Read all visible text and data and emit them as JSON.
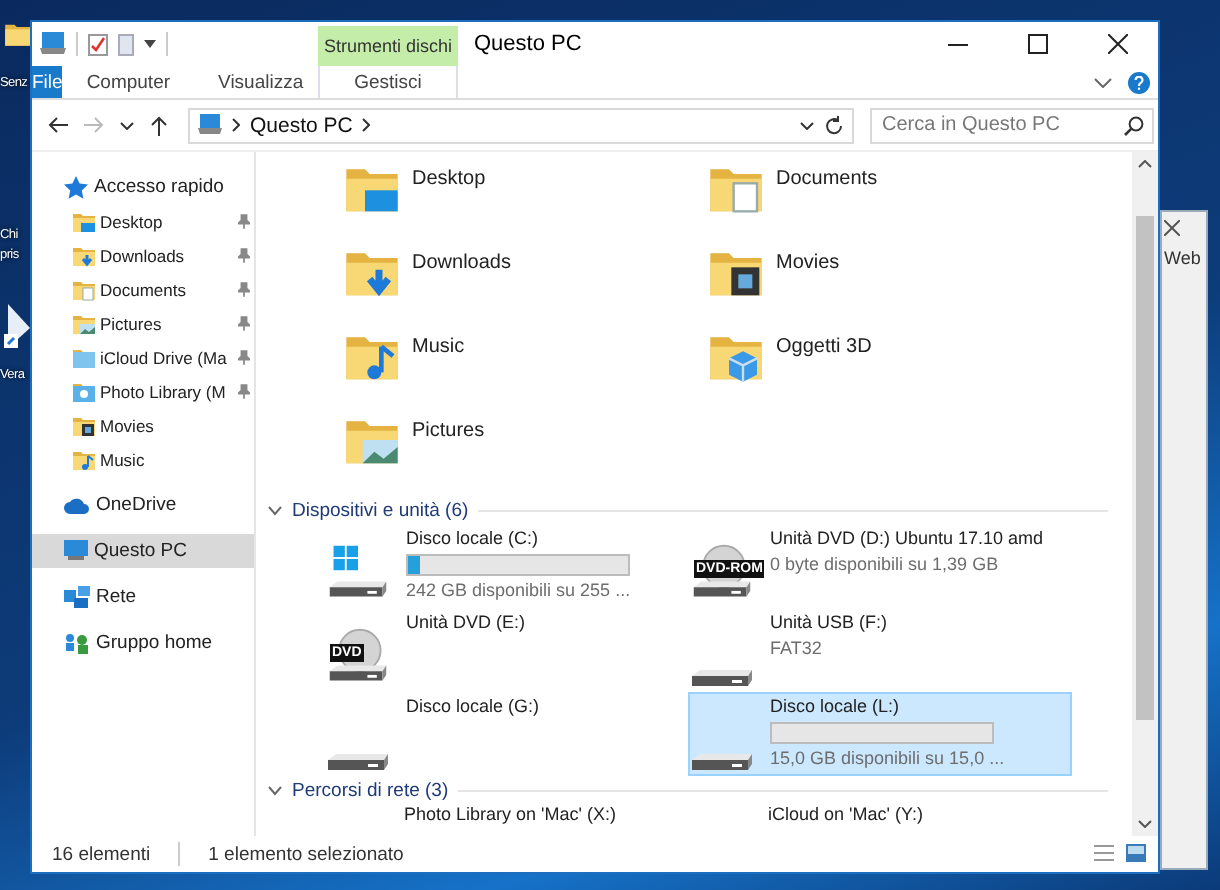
{
  "desktop": {
    "labels": [
      "Senz",
      "Chi",
      "pris",
      "Vera"
    ]
  },
  "background_window": {
    "text": "Web"
  },
  "window": {
    "title": "Questo PC",
    "tool_group": "Strumenti dischi",
    "ribbon_tabs": [
      {
        "label": "File",
        "kind": "file"
      },
      {
        "label": "Computer",
        "kind": "tab"
      },
      {
        "label": "Visualizza",
        "kind": "tab"
      },
      {
        "label": "Gestisci",
        "kind": "tool"
      }
    ]
  },
  "address": {
    "crumbs": [
      "Questo PC"
    ]
  },
  "search": {
    "placeholder": "Cerca in Questo PC"
  },
  "sidebar": {
    "items": [
      {
        "label": "Accesso rapido",
        "kind": "quick",
        "selected": false,
        "children": [
          {
            "label": "Desktop",
            "kind": "desktop",
            "pinned": true,
            "selected": false
          },
          {
            "label": "Downloads",
            "kind": "downloads",
            "pinned": true,
            "selected": false
          },
          {
            "label": "Documents",
            "kind": "documents",
            "pinned": true,
            "selected": false
          },
          {
            "label": "Pictures",
            "kind": "pictures",
            "pinned": true,
            "selected": false
          },
          {
            "label": "iCloud Drive (Ma",
            "kind": "cloudfolder",
            "pinned": true,
            "selected": false
          },
          {
            "label": "Photo Library (M",
            "kind": "photos",
            "pinned": true,
            "selected": false
          },
          {
            "label": "Movies",
            "kind": "movies",
            "pinned": false,
            "selected": false
          },
          {
            "label": "Music",
            "kind": "music",
            "pinned": false,
            "selected": false
          }
        ]
      },
      {
        "label": "OneDrive",
        "kind": "onedrive",
        "selected": false
      },
      {
        "label": "Questo PC",
        "kind": "pc",
        "selected": true
      },
      {
        "label": "Rete",
        "kind": "network",
        "selected": false
      },
      {
        "label": "Gruppo home",
        "kind": "homegroup",
        "selected": false
      }
    ]
  },
  "folders": [
    {
      "name": "Desktop",
      "kind": "desktop"
    },
    {
      "name": "Documents",
      "kind": "documents"
    },
    {
      "name": "Downloads",
      "kind": "downloads"
    },
    {
      "name": "Movies",
      "kind": "movies"
    },
    {
      "name": "Music",
      "kind": "music"
    },
    {
      "name": "Oggetti 3D",
      "kind": "cube"
    },
    {
      "name": "Pictures",
      "kind": "pictures"
    }
  ],
  "sections": [
    {
      "title": "Dispositivi e unità (6)",
      "expanded": true,
      "items": [
        {
          "name": "Disco locale (C:)",
          "kind": "hdd-windows",
          "level": 0.05,
          "detail": "242 GB disponibili su 255 ...",
          "selected": false
        },
        {
          "name": "Unità DVD (D:) Ubuntu 17.10 amd",
          "kind": "dvd-rom",
          "icon_label": "DVD-ROM",
          "detail": "0 byte disponibili su 1,39 GB",
          "selected": false
        },
        {
          "name": "Unità DVD (E:)",
          "kind": "dvd",
          "icon_label": "DVD",
          "selected": false
        },
        {
          "name": "Unità USB (F:)",
          "kind": "hdd",
          "detail": "FAT32",
          "selected": false
        },
        {
          "name": "Disco locale (G:)",
          "kind": "hdd",
          "selected": false
        },
        {
          "name": "Disco locale (L:)",
          "kind": "hdd",
          "level": 0,
          "detail": "15,0 GB disponibili su 15,0 ...",
          "selected": true
        }
      ]
    },
    {
      "title": "Percorsi di rete (3)",
      "expanded": true,
      "items": [
        {
          "name": "Photo Library on 'Mac' (X:)",
          "kind": "share",
          "selected": false
        },
        {
          "name": "iCloud on 'Mac' (Y:)",
          "kind": "share",
          "selected": false
        }
      ]
    }
  ],
  "status_bar": {
    "count": "16 elementi",
    "selection": "1 elemento selezionato"
  }
}
